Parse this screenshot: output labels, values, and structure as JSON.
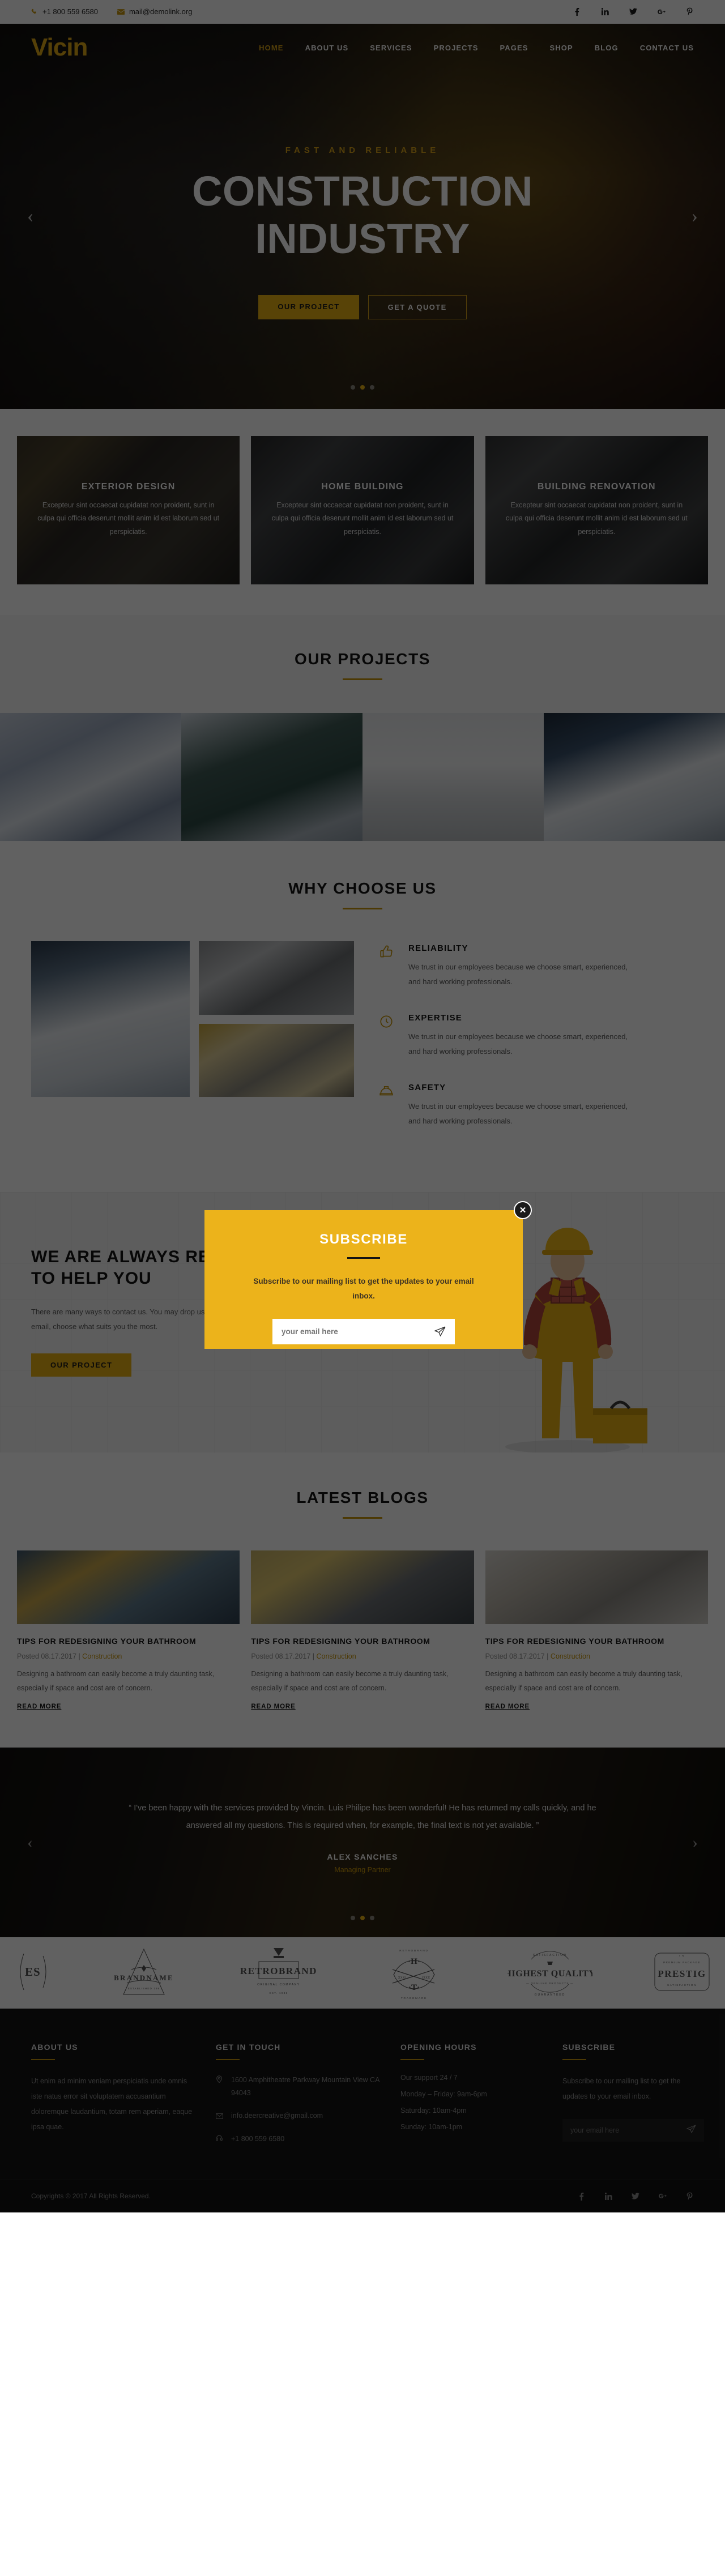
{
  "topbar": {
    "phone": "+1 800 559 6580",
    "email": "mail@demolink.org",
    "socials": [
      "facebook-icon",
      "linkedin-icon",
      "twitter-icon",
      "googleplus-icon",
      "pinterest-icon"
    ]
  },
  "header": {
    "logo": "Vicin",
    "nav": [
      {
        "label": "HOME",
        "active": true
      },
      {
        "label": "ABOUT US",
        "active": false
      },
      {
        "label": "SERVICES",
        "active": false
      },
      {
        "label": "PROJECTS",
        "active": false
      },
      {
        "label": "PAGES",
        "active": false
      },
      {
        "label": "SHOP",
        "active": false
      },
      {
        "label": "BLOG",
        "active": false
      },
      {
        "label": "CONTACT US",
        "active": false
      }
    ]
  },
  "hero": {
    "eyebrow": "FAST AND RELIABLE",
    "title_line1": "CONSTRUCTION",
    "title_line2": "INDUSTRY",
    "btn_primary": "OUR PROJECT",
    "btn_secondary": "GET A QUOTE",
    "prev": "‹",
    "next": "›",
    "slides": 3,
    "active_slide": 1
  },
  "services": [
    {
      "title": "EXTERIOR DESIGN",
      "text": "Excepteur sint occaecat cupidatat non proident, sunt in culpa qui officia deserunt mollit anim id est laborum sed ut perspiciatis."
    },
    {
      "title": "HOME BUILDING",
      "text": "Excepteur sint occaecat cupidatat non proident, sunt in culpa qui officia deserunt mollit anim id est laborum sed ut perspiciatis."
    },
    {
      "title": "BUILDING RENOVATION",
      "text": "Excepteur sint occaecat cupidatat non proident, sunt in culpa qui officia deserunt mollit anim id est laborum sed ut perspiciatis."
    }
  ],
  "projects": {
    "title": "OUR PROJECTS"
  },
  "why": {
    "title": "WHY CHOOSE US",
    "features": [
      {
        "icon": "thumbs-up-icon",
        "title": "RELIABILITY",
        "text": "We trust in our employees because we choose smart, experienced, and hard working professionals."
      },
      {
        "icon": "clock-icon",
        "title": "EXPERTISE",
        "text": "We trust in our employees because we choose smart, experienced, and hard working professionals."
      },
      {
        "icon": "helmet-icon",
        "title": "SAFETY",
        "text": "We trust in our employees because we choose smart, experienced, and hard working professionals."
      }
    ]
  },
  "help": {
    "title_line1": "WE ARE ALWAYS READY",
    "title_line2": "TO HELP YOU",
    "text": "There are many ways to contact us. You may drop us a line, give us a call or send an email, choose what suits you the most.",
    "button": "OUR PROJECT"
  },
  "blogs": {
    "title": "LATEST BLOGS",
    "posts": [
      {
        "title": "TIPS FOR REDESIGNING YOUR BATHROOM",
        "posted": "Posted 08.17.2017",
        "sep": "|",
        "category": "Construction",
        "excerpt": "Designing a bathroom can easily become a truly daunting task, especially if space and cost are of concern.",
        "more": "READ MORE"
      },
      {
        "title": "TIPS FOR REDESIGNING YOUR BATHROOM",
        "posted": "Posted 08.17.2017",
        "sep": "|",
        "category": "Construction",
        "excerpt": "Designing a bathroom can easily become a truly daunting task, especially if space and cost are of concern.",
        "more": "READ MORE"
      },
      {
        "title": "TIPS FOR REDESIGNING YOUR BATHROOM",
        "posted": "Posted 08.17.2017",
        "sep": "|",
        "category": "Construction",
        "excerpt": "Designing a bathroom can easily become a truly daunting task, especially if space and cost are of concern.",
        "more": "READ MORE"
      }
    ]
  },
  "testimonial": {
    "quote": "“ I've been happy with the services provided by Vincin. Luis Philipe has been wonderful! He has returned my calls quickly, and he answered all my questions. This is required when, for example, the final text is not yet available. ”",
    "name": "ALEX SANCHES",
    "role": "Managing Partner",
    "prev": "‹",
    "next": "›",
    "slides": 3,
    "active_slide": 1
  },
  "brands": [
    {
      "name": "ES"
    },
    {
      "name": "BRANDNAME",
      "sub": "ESTABLISHED 199"
    },
    {
      "name": "RETROBRAND",
      "sub": "ORIGINAL COMPANY"
    },
    {
      "name": "H T",
      "sub": "RETROBRAND TRADEMARK"
    },
    {
      "name": "HIGHEST QUALITY",
      "sub": "SATISFACTION GUARANTEED"
    },
    {
      "name": "PRESTIG",
      "sub": "SATISFACTION"
    }
  ],
  "footer": {
    "about": {
      "title": "ABOUT US",
      "text": "Ut enim ad minim veniam perspiciatis unde omnis iste natus error sit voluptatem accusantium doloremque laudantium, totam rem aperiam, eaque ipsa quae."
    },
    "touch": {
      "title": "GET IN TOUCH",
      "rows": [
        {
          "icon": "map-pin-icon",
          "text": "1600 Amphitheatre Parkway Mountain View CA 94043"
        },
        {
          "icon": "envelope-icon",
          "text": "info.deercreative@gmail.com"
        },
        {
          "icon": "phone-icon",
          "text": "+1 800 559 6580"
        }
      ]
    },
    "hours": {
      "title": "OPENING HOURS",
      "rows": [
        "Our support 24 / 7",
        "Monday – Friday: 9am-6pm",
        "Saturday: 10am-4pm",
        "Sunday: 10am-1pm"
      ]
    },
    "subscribe": {
      "title": "SUBSCRIBE",
      "text": "Subscribe to our mailing list to get the updates to your email inbox.",
      "placeholder": "your email here",
      "value": ""
    },
    "copyright": "Copyrights © 2017 All Rights Reserved.",
    "socials": [
      "facebook-icon",
      "linkedin-icon",
      "twitter-icon",
      "googleplus-icon",
      "pinterest-icon"
    ]
  },
  "modal": {
    "title": "SUBSCRIBE",
    "text": "Subscribe to our mailing list to get the updates to your email inbox.",
    "placeholder": "your email here",
    "value": "",
    "close_label": "✕"
  },
  "colors": {
    "accent": "#ecb31b",
    "accent_dark": "#c8960c",
    "logo": "#e0a816",
    "dark": "#141414"
  }
}
